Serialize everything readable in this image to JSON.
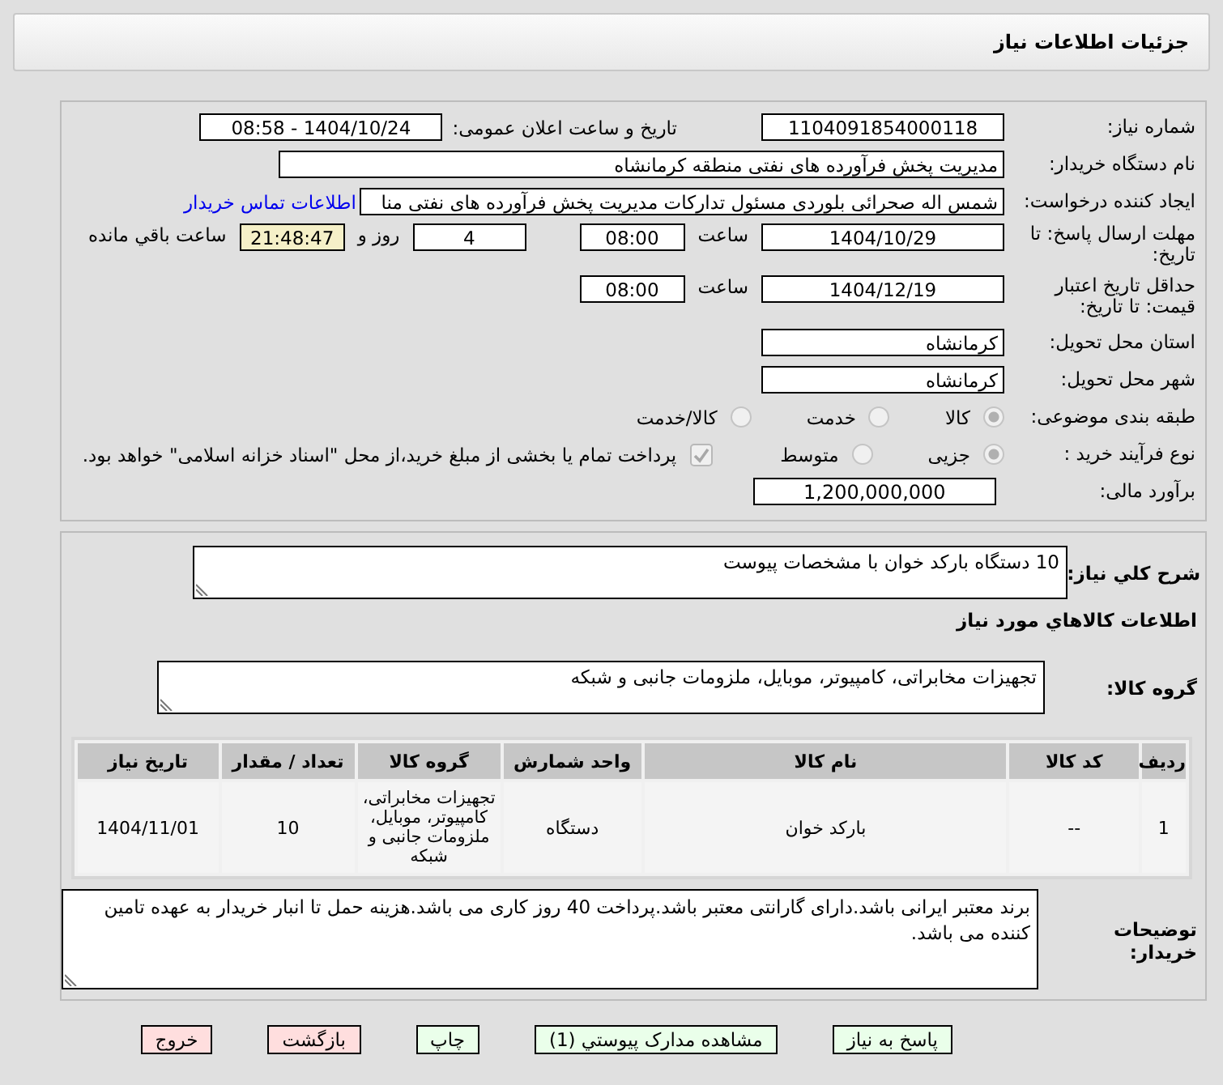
{
  "header": {
    "title": "جزئیات اطلاعات نیاز"
  },
  "details": {
    "need_number": {
      "label": "شماره نیاز:",
      "value": "1104091854000118"
    },
    "announce": {
      "label": "تاریخ و ساعت اعلان عمومی:",
      "value": "1404/10/24 - 08:58"
    },
    "buyer_org": {
      "label": "نام دستگاه خریدار:",
      "value": "مدیریت پخش فرآورده های نفتی منطقه کرمانشاه"
    },
    "requester": {
      "label": "ایجاد کننده درخواست:",
      "value": "شمس اله صحرائی بلوردی مسئول تدارکات  مدیریت پخش فرآورده های نفتی منا",
      "link": "اطلاعات تماس خریدار"
    },
    "deadline": {
      "label": "مهلت ارسال پاسخ: تا تاریخ:",
      "date": "1404/10/29",
      "time_label": "ساعت",
      "time": "08:00",
      "days": "4",
      "days_label": "روز و",
      "remaining": "21:48:47",
      "remaining_label": "ساعت باقي مانده"
    },
    "validity": {
      "label": "حداقل تاریخ اعتبار قیمت: تا تاریخ:",
      "date": "1404/12/19",
      "time_label": "ساعت",
      "time": "08:00"
    },
    "province": {
      "label": "استان محل تحویل:",
      "value": "کرمانشاه"
    },
    "city": {
      "label": "شهر محل تحویل:",
      "value": "کرمانشاه"
    },
    "category": {
      "label": "طبقه بندی موضوعی:",
      "options": [
        {
          "label": "کالا",
          "selected": true
        },
        {
          "label": "خدمت",
          "selected": false
        },
        {
          "label": "کالا/خدمت",
          "selected": false
        }
      ]
    },
    "process": {
      "label": "نوع فرآیند خرید :",
      "options": [
        {
          "label": "جزیی",
          "selected": true
        },
        {
          "label": "متوسط",
          "selected": false
        }
      ],
      "treasury": {
        "checked": true,
        "text": "پرداخت تمام یا بخشی از مبلغ خرید،از محل \"اسناد خزانه اسلامی\" خواهد بود."
      }
    },
    "budget": {
      "label": "برآورد مالی:",
      "value": "1,200,000,000"
    }
  },
  "description": {
    "label": "شرح کلي نیاز:",
    "value": "10 دستگاه بارکد خوان با مشخصات پیوست"
  },
  "items_heading": "اطلاعات کالاهاي مورد نیاز",
  "goods_group": {
    "label": "گروه کالا:",
    "value": "تجهیزات مخابراتی، کامپیوتر، موبایل، ملزومات جانبی و شبکه"
  },
  "table": {
    "columns": [
      "ردیف",
      "کد کالا",
      "نام کالا",
      "واحد شمارش",
      "گروه کالا",
      "تعداد / مقدار",
      "تاریخ نیاز"
    ],
    "rows": [
      [
        "1",
        "--",
        "بارکد خوان",
        "دستگاه",
        "تجهیزات مخابراتی، کامپیوتر، موبایل، ملزومات جانبی و شبکه",
        "10",
        "1404/11/01"
      ]
    ]
  },
  "buyer_notes": {
    "label": "توضیحات خریدار:",
    "value": "برند معتبر ایرانی باشد.دارای گارانتی معتبر باشد.پرداخت 40 روز کاری می باشد.هزینه حمل تا انبار خریدار به عهده تامین کننده می باشد."
  },
  "buttons": [
    {
      "label": "پاسخ به نیاز",
      "kind": "primary"
    },
    {
      "label": "مشاهده مدارک پیوستي (1)",
      "kind": "primary"
    },
    {
      "label": "چاپ",
      "kind": "primary"
    },
    {
      "label": "بازگشت",
      "kind": "danger"
    },
    {
      "label": "خروج",
      "kind": "danger"
    }
  ]
}
